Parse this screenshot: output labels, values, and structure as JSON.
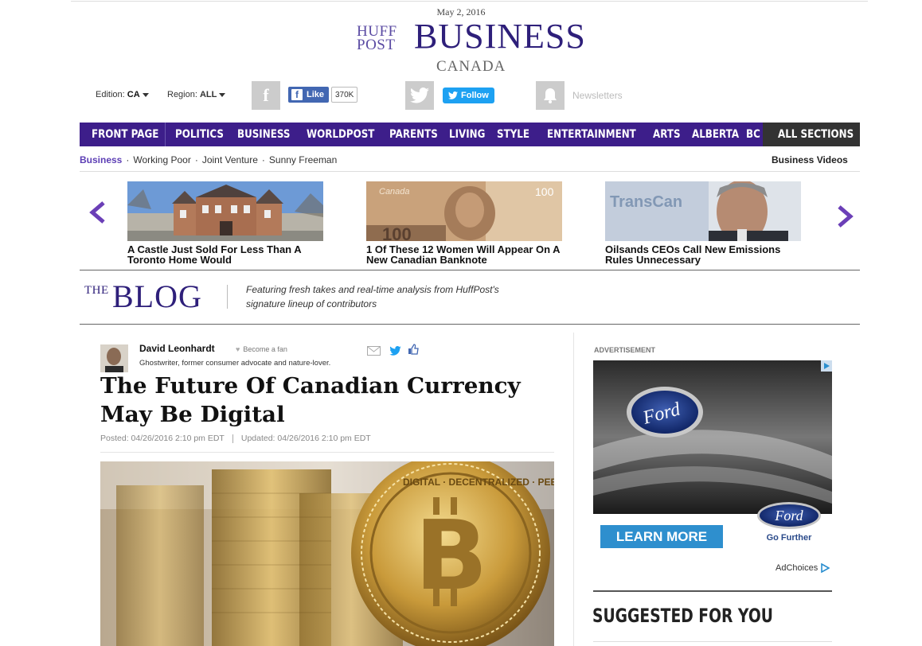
{
  "header": {
    "date": "May 2, 2016",
    "logo_huff": "HUFF",
    "logo_post": "POST",
    "section_title": "BUSINESS",
    "edition_name": "CANADA"
  },
  "toolbar": {
    "edition_label": "Edition:",
    "edition_value": "CA",
    "region_label": "Region:",
    "region_value": "ALL",
    "fb_like_label": "Like",
    "fb_like_count": "370K",
    "twitter_follow_label": "Follow",
    "newsletters_label": "Newsletters"
  },
  "nav": {
    "items": [
      "FRONT PAGE",
      "POLITICS",
      "BUSINESS",
      "WORLDPOST",
      "PARENTS",
      "LIVING",
      "STYLE",
      "ENTERTAINMENT",
      "ARTS",
      "ALBERTA",
      "BC"
    ],
    "all_sections": "ALL SECTIONS",
    "bg_color": "#3d1e8a"
  },
  "subnav": {
    "section": "Business",
    "links": [
      "Working Poor",
      "Joint Venture",
      "Sunny Freeman"
    ],
    "videos": "Business Videos"
  },
  "carousel": {
    "prev_icon": "chevron-left-icon",
    "next_icon": "chevron-right-icon",
    "items": [
      {
        "title": "A Castle Just Sold For Less Than A Toronto Home Would"
      },
      {
        "title": "1 Of These 12 Women Will Appear On A New Canadian Banknote",
        "image_text": "Canada",
        "image_number": "100"
      },
      {
        "title": "Oilsands CEOs Call New Emissions Rules Unnecessary",
        "image_text": "TransCan"
      }
    ]
  },
  "blog_banner": {
    "the": "THE",
    "blog": "BLOG",
    "description": "Featuring fresh takes and real-time analysis from HuffPost's signature lineup of contributors"
  },
  "article": {
    "author": "David Leonhardt",
    "become_fan": "Become a fan",
    "bio": "Ghostwriter, former consumer advocate and nature-lover.",
    "headline": "The Future Of Canadian Currency May Be Digital",
    "posted": "Posted: 04/26/2016 2:10 pm EDT",
    "updated": "Updated: 04/26/2016 2:10 pm EDT",
    "coin_text": "DIGITAL · DECENTRALIZED · PEER TO PEER"
  },
  "sidebar": {
    "ad_label": "ADVERTISEMENT",
    "ad_brand": "Ford",
    "ad_cta": "LEARN MORE",
    "ad_tagline": "Go Further",
    "adchoices": "AdChoices",
    "suggested": "SUGGESTED FOR YOU"
  }
}
